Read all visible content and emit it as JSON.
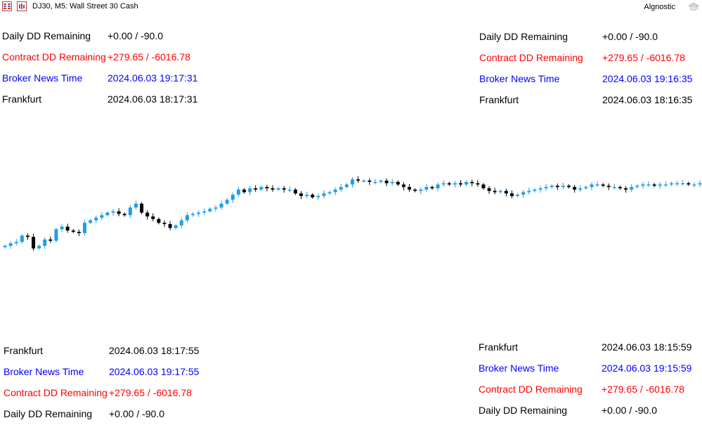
{
  "header": {
    "symbol_label": "DJ30, M5:  Wall Street 30 Cash",
    "right_label": "Algnostic",
    "icons": [
      "bars-list-icon",
      "chart-window-icon",
      "graduation-cap-icon"
    ]
  },
  "colors": {
    "black": "#000000",
    "red": "#ff0000",
    "blue": "#0000ff",
    "bull_candle": "#1e9ee8",
    "bear_candle": "#000000"
  },
  "panels": {
    "top_left": {
      "rows": [
        {
          "label": "Daily DD Remaining",
          "value": "+0.00 / -90.0",
          "color": "black"
        },
        {
          "label": "Contract DD Remaining",
          "value": "+279.65 / -6016.78",
          "color": "red"
        },
        {
          "label": "Broker News Time",
          "value": "2024.06.03 19:17:31",
          "color": "blue"
        },
        {
          "label": "Frankfurt",
          "value": "2024.06.03 18:17:31",
          "color": "black"
        }
      ]
    },
    "top_right": {
      "rows": [
        {
          "label": "Daily DD Remaining",
          "value": "+0.00 / -90.0",
          "color": "black"
        },
        {
          "label": "Contract DD Remaining",
          "value": "+279.65 / -6016.78",
          "color": "red"
        },
        {
          "label": "Broker News Time",
          "value": "2024.06.03 19:16:35",
          "color": "blue"
        },
        {
          "label": "Frankfurt",
          "value": "2024.06.03 18:16:35",
          "color": "black"
        }
      ]
    },
    "bottom_left": {
      "rows": [
        {
          "label": "Frankfurt",
          "value": "2024.06.03 18:17:55",
          "color": "black"
        },
        {
          "label": "Broker News Time",
          "value": "2024.06.03 19:17:55",
          "color": "blue"
        },
        {
          "label": "Contract DD Remaining",
          "value": "+279.65 / -6016.78",
          "color": "red"
        },
        {
          "label": "Daily DD Remaining",
          "value": "+0.00 / -90.0",
          "color": "black"
        }
      ]
    },
    "bottom_right": {
      "rows": [
        {
          "label": "Frankfurt",
          "value": "2024.06.03 18:15:59",
          "color": "black"
        },
        {
          "label": "Broker News Time",
          "value": "2024.06.03 19:15:59",
          "color": "blue"
        },
        {
          "label": "Contract DD Remaining",
          "value": "+279.65 / -6016.78",
          "color": "red"
        },
        {
          "label": "Daily DD Remaining",
          "value": "+0.00 / -90.0",
          "color": "black"
        }
      ]
    }
  },
  "chart_data": {
    "type": "candlestick",
    "price_range": [
      0,
      100
    ],
    "closes": [
      22,
      24,
      25,
      30,
      29,
      20,
      22,
      27,
      26,
      35,
      37,
      34,
      33,
      32,
      40,
      42,
      44,
      46,
      48,
      49,
      47,
      46,
      52,
      55,
      48,
      45,
      43,
      40,
      39,
      36,
      38,
      42,
      46,
      47,
      48,
      49,
      51,
      52,
      55,
      58,
      62,
      66,
      64,
      67,
      66,
      68,
      67,
      66,
      67,
      66,
      66,
      63,
      61,
      62,
      60,
      61,
      63,
      64,
      66,
      68,
      70,
      74,
      73,
      73,
      72,
      72,
      73,
      71,
      72,
      70,
      68,
      66,
      65,
      66,
      68,
      67,
      70,
      71,
      70,
      71,
      70,
      72,
      71,
      70,
      67,
      65,
      64,
      65,
      63,
      61,
      62,
      64,
      65,
      66,
      67,
      68,
      69,
      68,
      69,
      68,
      66,
      67,
      68,
      70,
      70,
      69,
      68,
      68,
      67,
      66,
      68,
      69,
      70,
      70,
      69,
      70,
      70,
      71,
      71,
      71,
      70,
      70,
      71
    ],
    "candles_note": ""
  }
}
